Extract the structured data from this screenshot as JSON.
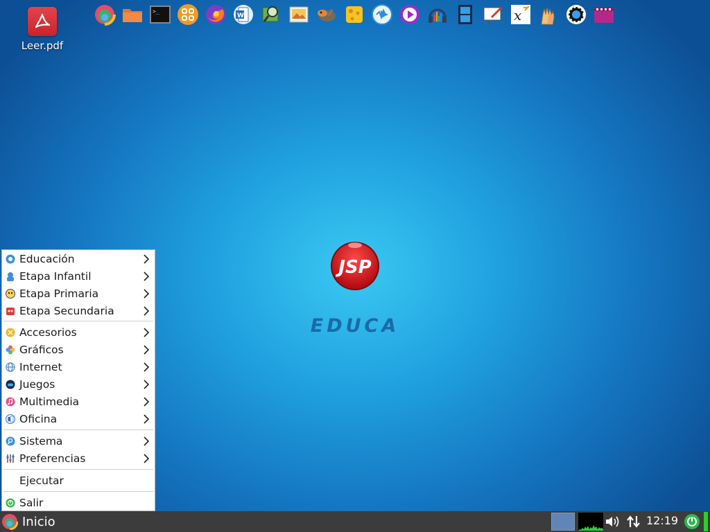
{
  "desktop": {
    "file_icon": {
      "label": "Leer.pdf",
      "icon": "pdf-icon"
    },
    "logo": {
      "brand": "JSP",
      "subtitle": "EDUCA"
    }
  },
  "dock": {
    "icons": [
      "multicolor-ring-icon",
      "folder-icon",
      "terminal-icon",
      "app-grid-icon",
      "firefox-icon",
      "word-processor-icon",
      "image-search-icon",
      "image-viewer-icon",
      "gimp-icon",
      "cheese-icon",
      "audio-player-icon",
      "media-player-icon",
      "headphones-icon",
      "video-editor-icon",
      "whiteboard-icon",
      "math-editor-icon",
      "hands-icon",
      "settings-gear-icon",
      "film-icon"
    ]
  },
  "start_menu": {
    "items": [
      {
        "label": "Educación",
        "icon": "education-icon",
        "submenu": true
      },
      {
        "label": "Etapa Infantil",
        "icon": "infantil-icon",
        "submenu": true
      },
      {
        "label": "Etapa Primaria",
        "icon": "primaria-icon",
        "submenu": true
      },
      {
        "label": "Etapa Secundaria",
        "icon": "secundaria-icon",
        "submenu": true
      },
      {
        "label": "Accesorios",
        "icon": "accessories-icon",
        "submenu": true
      },
      {
        "label": "Gráficos",
        "icon": "graphics-icon",
        "submenu": true
      },
      {
        "label": "Internet",
        "icon": "internet-icon",
        "submenu": true
      },
      {
        "label": "Juegos",
        "icon": "games-icon",
        "submenu": true
      },
      {
        "label": "Multimedia",
        "icon": "multimedia-icon",
        "submenu": true
      },
      {
        "label": "Oficina",
        "icon": "office-icon",
        "submenu": true
      },
      {
        "label": "Sistema",
        "icon": "system-icon",
        "submenu": true
      },
      {
        "label": "Preferencias",
        "icon": "preferences-icon",
        "submenu": true
      },
      {
        "label": "Ejecutar",
        "icon": "",
        "submenu": false
      },
      {
        "label": "Salir",
        "icon": "exit-icon",
        "submenu": false
      }
    ]
  },
  "taskbar": {
    "start_label": "Inicio",
    "clock": "12:19"
  },
  "colors": {
    "accent": "#1f9fde",
    "taskbar": "#3c3c3c",
    "logo_red": "#d3121b"
  }
}
